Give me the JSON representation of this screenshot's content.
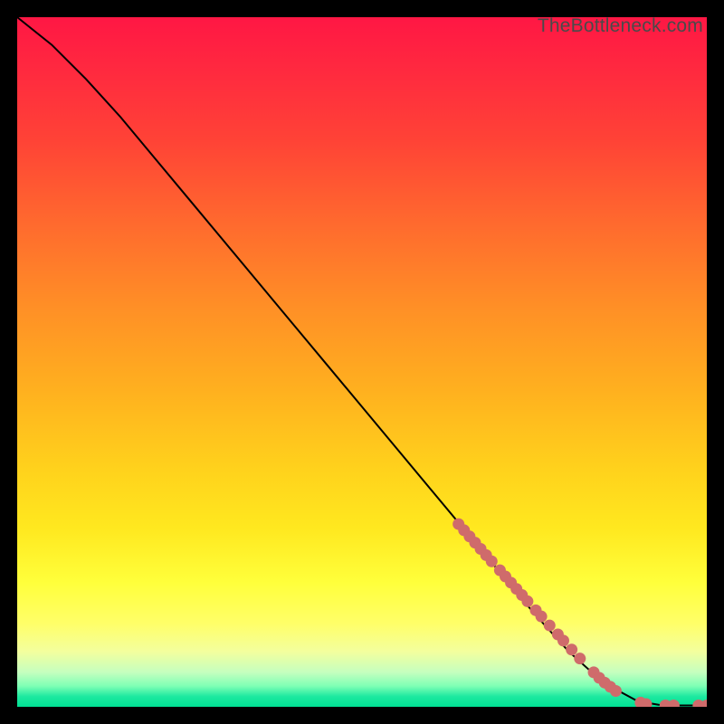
{
  "watermark": "TheBottleneck.com",
  "chart_data": {
    "type": "line",
    "title": "",
    "xlabel": "",
    "ylabel": "",
    "xlim": [
      0,
      100
    ],
    "ylim": [
      0,
      100
    ],
    "grid": false,
    "legend": false,
    "series": [
      {
        "name": "curve",
        "x": [
          0,
          5,
          10,
          15,
          20,
          25,
          30,
          35,
          40,
          45,
          50,
          55,
          60,
          65,
          70,
          75,
          80,
          85,
          90,
          93,
          95,
          97,
          100
        ],
        "y": [
          100,
          96,
          91,
          85.5,
          79.5,
          73.5,
          67.5,
          61.5,
          55.5,
          49.5,
          43.5,
          37.5,
          31.5,
          25.5,
          19.5,
          13.5,
          8.0,
          3.5,
          0.8,
          0.3,
          0.2,
          0.2,
          0.2
        ]
      }
    ],
    "markers": {
      "name": "dots",
      "color": "#cf6b6b",
      "points": [
        {
          "x": 64.0,
          "y": 26.5
        },
        {
          "x": 64.8,
          "y": 25.6
        },
        {
          "x": 65.6,
          "y": 24.7
        },
        {
          "x": 66.4,
          "y": 23.8
        },
        {
          "x": 67.2,
          "y": 22.9
        },
        {
          "x": 68.0,
          "y": 22.0
        },
        {
          "x": 68.8,
          "y": 21.1
        },
        {
          "x": 70.0,
          "y": 19.8
        },
        {
          "x": 70.8,
          "y": 18.9
        },
        {
          "x": 71.6,
          "y": 18.0
        },
        {
          "x": 72.4,
          "y": 17.1
        },
        {
          "x": 73.2,
          "y": 16.2
        },
        {
          "x": 74.0,
          "y": 15.3
        },
        {
          "x": 75.2,
          "y": 14.0
        },
        {
          "x": 76.0,
          "y": 13.1
        },
        {
          "x": 77.2,
          "y": 11.8
        },
        {
          "x": 78.4,
          "y": 10.5
        },
        {
          "x": 79.2,
          "y": 9.6
        },
        {
          "x": 80.4,
          "y": 8.3
        },
        {
          "x": 81.6,
          "y": 7.0
        },
        {
          "x": 83.6,
          "y": 5.0
        },
        {
          "x": 84.4,
          "y": 4.2
        },
        {
          "x": 85.2,
          "y": 3.5
        },
        {
          "x": 86.0,
          "y": 2.9
        },
        {
          "x": 86.8,
          "y": 2.3
        },
        {
          "x": 90.4,
          "y": 0.6
        },
        {
          "x": 91.2,
          "y": 0.4
        },
        {
          "x": 94.0,
          "y": 0.2
        },
        {
          "x": 95.2,
          "y": 0.2
        },
        {
          "x": 98.8,
          "y": 0.2
        },
        {
          "x": 100.0,
          "y": 0.2
        }
      ]
    }
  }
}
